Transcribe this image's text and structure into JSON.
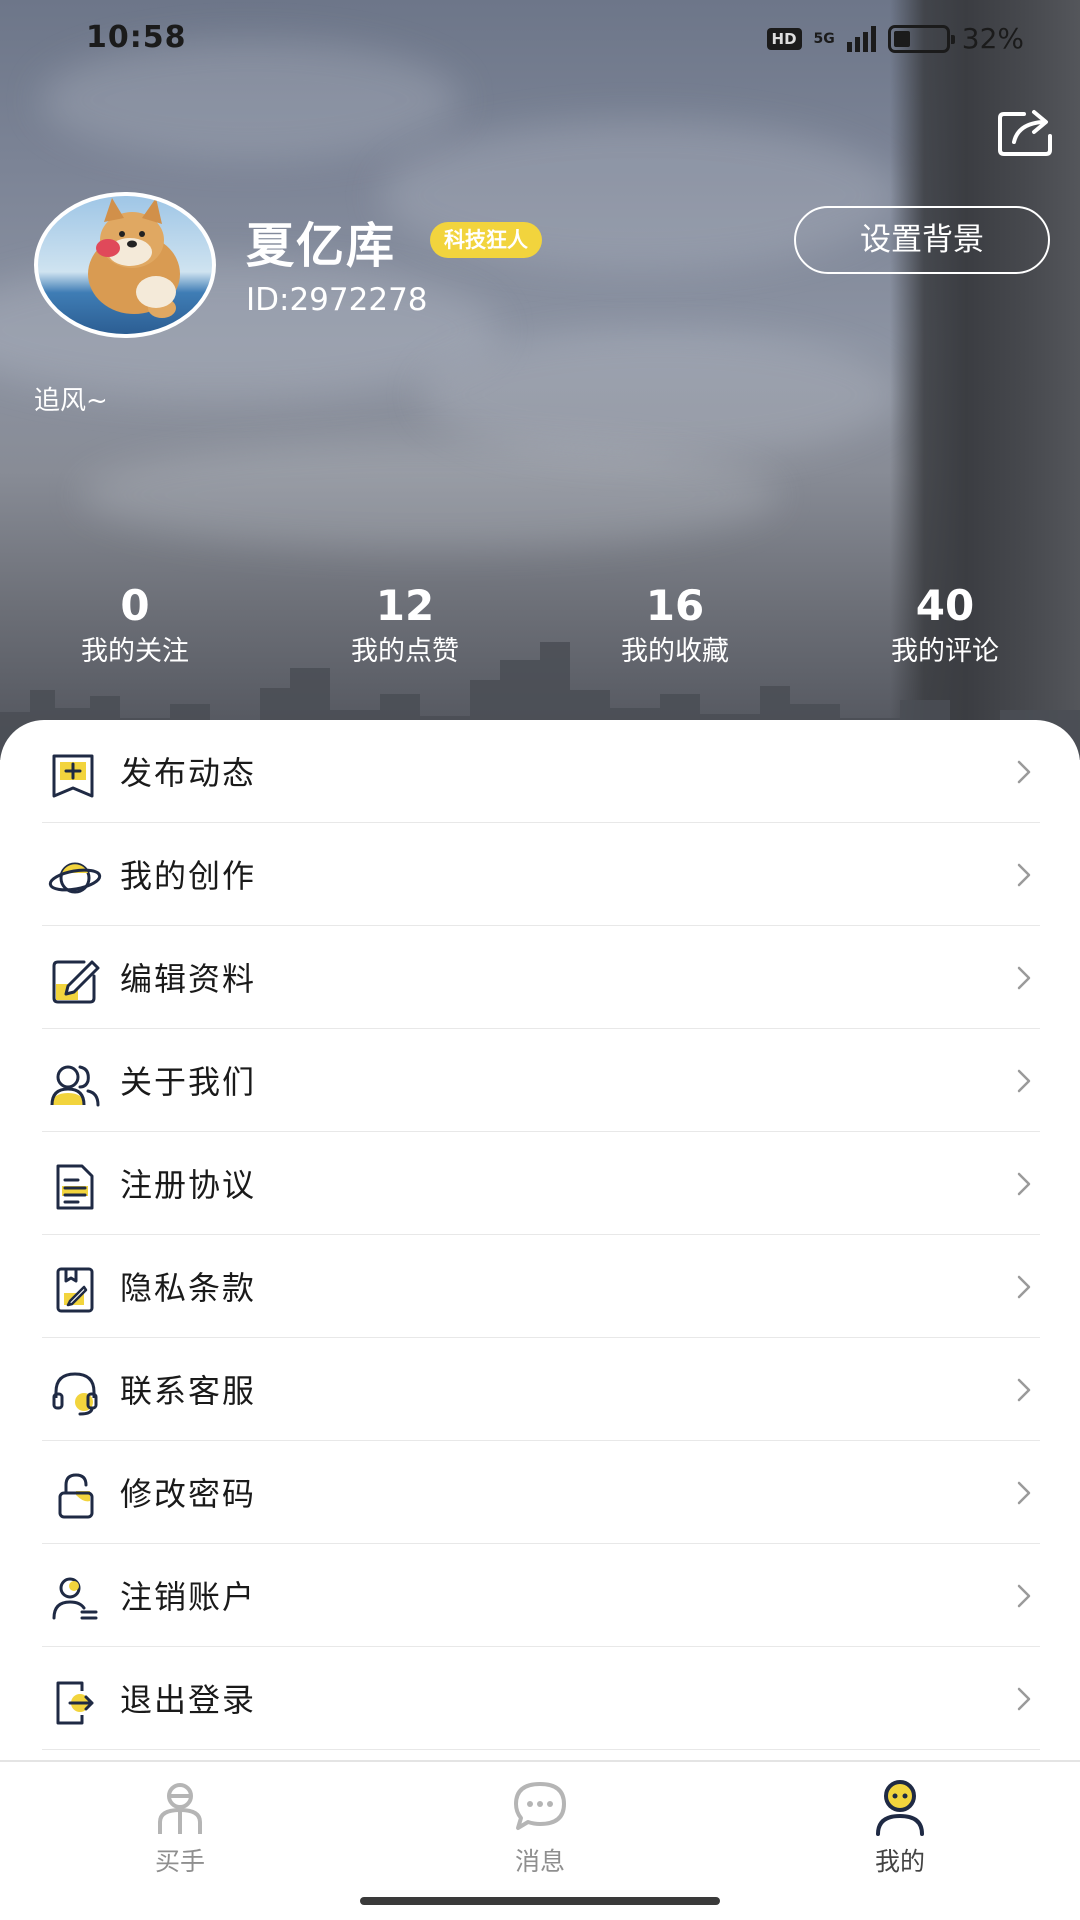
{
  "status_bar": {
    "time": "10:58",
    "hd": "HD",
    "network": "5G",
    "battery": "32%",
    "battery_level": 0.32
  },
  "profile": {
    "name": "夏亿库",
    "badge": "科技狂人",
    "id": "ID:2972278",
    "signature": "追风~",
    "set_background": "设置背景"
  },
  "stats": [
    {
      "value": "0",
      "label": "我的关注"
    },
    {
      "value": "12",
      "label": "我的点赞"
    },
    {
      "value": "16",
      "label": "我的收藏"
    },
    {
      "value": "40",
      "label": "我的评论"
    }
  ],
  "menu": [
    {
      "label": "发布动态",
      "icon": "publish-icon"
    },
    {
      "label": "我的创作",
      "icon": "planet-icon"
    },
    {
      "label": "编辑资料",
      "icon": "edit-icon"
    },
    {
      "label": "关于我们",
      "icon": "users-icon"
    },
    {
      "label": "注册协议",
      "icon": "document-icon"
    },
    {
      "label": "隐私条款",
      "icon": "privacy-icon"
    },
    {
      "label": "联系客服",
      "icon": "headset-icon"
    },
    {
      "label": "修改密码",
      "icon": "lock-icon"
    },
    {
      "label": "注销账户",
      "icon": "user-remove-icon"
    },
    {
      "label": "退出登录",
      "icon": "logout-icon"
    }
  ],
  "tabs": [
    {
      "label": "买手",
      "icon": "buyer-icon",
      "active": false
    },
    {
      "label": "消息",
      "icon": "message-icon",
      "active": false
    },
    {
      "label": "我的",
      "icon": "mine-icon",
      "active": true
    }
  ],
  "colors": {
    "accent_yellow": "#f2d43d",
    "icon_navy": "#1f2a44",
    "text_primary": "#1a1a1a",
    "tab_inactive": "#8f8f8f"
  }
}
